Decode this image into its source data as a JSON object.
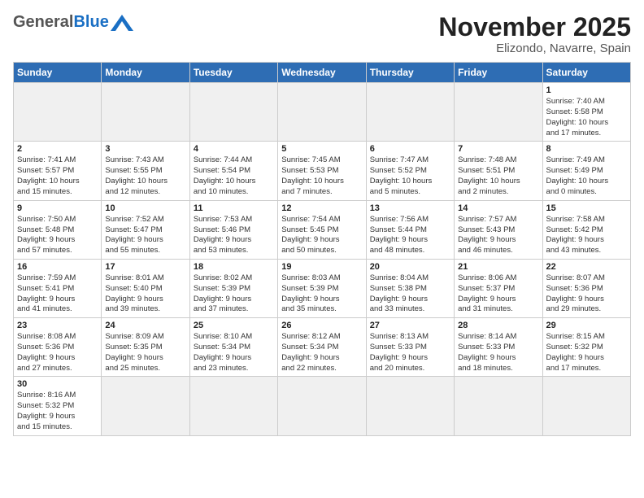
{
  "header": {
    "logo_general": "General",
    "logo_blue": "Blue",
    "month_title": "November 2025",
    "location": "Elizondo, Navarre, Spain"
  },
  "weekdays": [
    "Sunday",
    "Monday",
    "Tuesday",
    "Wednesday",
    "Thursday",
    "Friday",
    "Saturday"
  ],
  "weeks": [
    [
      {
        "day": "",
        "info": ""
      },
      {
        "day": "",
        "info": ""
      },
      {
        "day": "",
        "info": ""
      },
      {
        "day": "",
        "info": ""
      },
      {
        "day": "",
        "info": ""
      },
      {
        "day": "",
        "info": ""
      },
      {
        "day": "1",
        "info": "Sunrise: 7:40 AM\nSunset: 5:58 PM\nDaylight: 10 hours\nand 17 minutes."
      }
    ],
    [
      {
        "day": "2",
        "info": "Sunrise: 7:41 AM\nSunset: 5:57 PM\nDaylight: 10 hours\nand 15 minutes."
      },
      {
        "day": "3",
        "info": "Sunrise: 7:43 AM\nSunset: 5:55 PM\nDaylight: 10 hours\nand 12 minutes."
      },
      {
        "day": "4",
        "info": "Sunrise: 7:44 AM\nSunset: 5:54 PM\nDaylight: 10 hours\nand 10 minutes."
      },
      {
        "day": "5",
        "info": "Sunrise: 7:45 AM\nSunset: 5:53 PM\nDaylight: 10 hours\nand 7 minutes."
      },
      {
        "day": "6",
        "info": "Sunrise: 7:47 AM\nSunset: 5:52 PM\nDaylight: 10 hours\nand 5 minutes."
      },
      {
        "day": "7",
        "info": "Sunrise: 7:48 AM\nSunset: 5:51 PM\nDaylight: 10 hours\nand 2 minutes."
      },
      {
        "day": "8",
        "info": "Sunrise: 7:49 AM\nSunset: 5:49 PM\nDaylight: 10 hours\nand 0 minutes."
      }
    ],
    [
      {
        "day": "9",
        "info": "Sunrise: 7:50 AM\nSunset: 5:48 PM\nDaylight: 9 hours\nand 57 minutes."
      },
      {
        "day": "10",
        "info": "Sunrise: 7:52 AM\nSunset: 5:47 PM\nDaylight: 9 hours\nand 55 minutes."
      },
      {
        "day": "11",
        "info": "Sunrise: 7:53 AM\nSunset: 5:46 PM\nDaylight: 9 hours\nand 53 minutes."
      },
      {
        "day": "12",
        "info": "Sunrise: 7:54 AM\nSunset: 5:45 PM\nDaylight: 9 hours\nand 50 minutes."
      },
      {
        "day": "13",
        "info": "Sunrise: 7:56 AM\nSunset: 5:44 PM\nDaylight: 9 hours\nand 48 minutes."
      },
      {
        "day": "14",
        "info": "Sunrise: 7:57 AM\nSunset: 5:43 PM\nDaylight: 9 hours\nand 46 minutes."
      },
      {
        "day": "15",
        "info": "Sunrise: 7:58 AM\nSunset: 5:42 PM\nDaylight: 9 hours\nand 43 minutes."
      }
    ],
    [
      {
        "day": "16",
        "info": "Sunrise: 7:59 AM\nSunset: 5:41 PM\nDaylight: 9 hours\nand 41 minutes."
      },
      {
        "day": "17",
        "info": "Sunrise: 8:01 AM\nSunset: 5:40 PM\nDaylight: 9 hours\nand 39 minutes."
      },
      {
        "day": "18",
        "info": "Sunrise: 8:02 AM\nSunset: 5:39 PM\nDaylight: 9 hours\nand 37 minutes."
      },
      {
        "day": "19",
        "info": "Sunrise: 8:03 AM\nSunset: 5:39 PM\nDaylight: 9 hours\nand 35 minutes."
      },
      {
        "day": "20",
        "info": "Sunrise: 8:04 AM\nSunset: 5:38 PM\nDaylight: 9 hours\nand 33 minutes."
      },
      {
        "day": "21",
        "info": "Sunrise: 8:06 AM\nSunset: 5:37 PM\nDaylight: 9 hours\nand 31 minutes."
      },
      {
        "day": "22",
        "info": "Sunrise: 8:07 AM\nSunset: 5:36 PM\nDaylight: 9 hours\nand 29 minutes."
      }
    ],
    [
      {
        "day": "23",
        "info": "Sunrise: 8:08 AM\nSunset: 5:36 PM\nDaylight: 9 hours\nand 27 minutes."
      },
      {
        "day": "24",
        "info": "Sunrise: 8:09 AM\nSunset: 5:35 PM\nDaylight: 9 hours\nand 25 minutes."
      },
      {
        "day": "25",
        "info": "Sunrise: 8:10 AM\nSunset: 5:34 PM\nDaylight: 9 hours\nand 23 minutes."
      },
      {
        "day": "26",
        "info": "Sunrise: 8:12 AM\nSunset: 5:34 PM\nDaylight: 9 hours\nand 22 minutes."
      },
      {
        "day": "27",
        "info": "Sunrise: 8:13 AM\nSunset: 5:33 PM\nDaylight: 9 hours\nand 20 minutes."
      },
      {
        "day": "28",
        "info": "Sunrise: 8:14 AM\nSunset: 5:33 PM\nDaylight: 9 hours\nand 18 minutes."
      },
      {
        "day": "29",
        "info": "Sunrise: 8:15 AM\nSunset: 5:32 PM\nDaylight: 9 hours\nand 17 minutes."
      }
    ],
    [
      {
        "day": "30",
        "info": "Sunrise: 8:16 AM\nSunset: 5:32 PM\nDaylight: 9 hours\nand 15 minutes."
      },
      {
        "day": "",
        "info": ""
      },
      {
        "day": "",
        "info": ""
      },
      {
        "day": "",
        "info": ""
      },
      {
        "day": "",
        "info": ""
      },
      {
        "day": "",
        "info": ""
      },
      {
        "day": "",
        "info": ""
      }
    ]
  ]
}
